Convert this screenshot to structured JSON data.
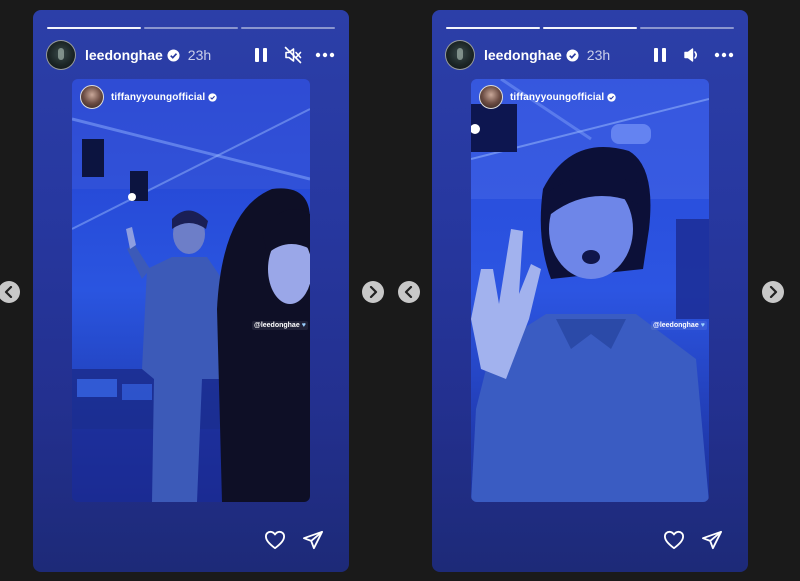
{
  "stories": [
    {
      "username": "leedonghae",
      "time": "23h",
      "reshared_username": "tiffanyyoungofficial",
      "mention": "@leedonghae",
      "audio_icon": "speaker-muted-icon"
    },
    {
      "username": "leedonghae",
      "time": "23h",
      "reshared_username": "tiffanyyoungofficial",
      "mention": "@leedonghae",
      "audio_icon": "speaker-on-icon"
    }
  ],
  "progress": [
    {
      "done": 1,
      "total": 3
    },
    {
      "done": 2,
      "total": 3
    }
  ],
  "icons": [
    "pause-icon",
    "more-options-icon",
    "heart-icon",
    "share-icon",
    "verified-icon",
    "chevron-left-icon",
    "chevron-right-icon"
  ],
  "colors": {
    "page_bg": "#1a1a1a",
    "story_bg": "#2738a0",
    "verified": "#3897f0"
  }
}
